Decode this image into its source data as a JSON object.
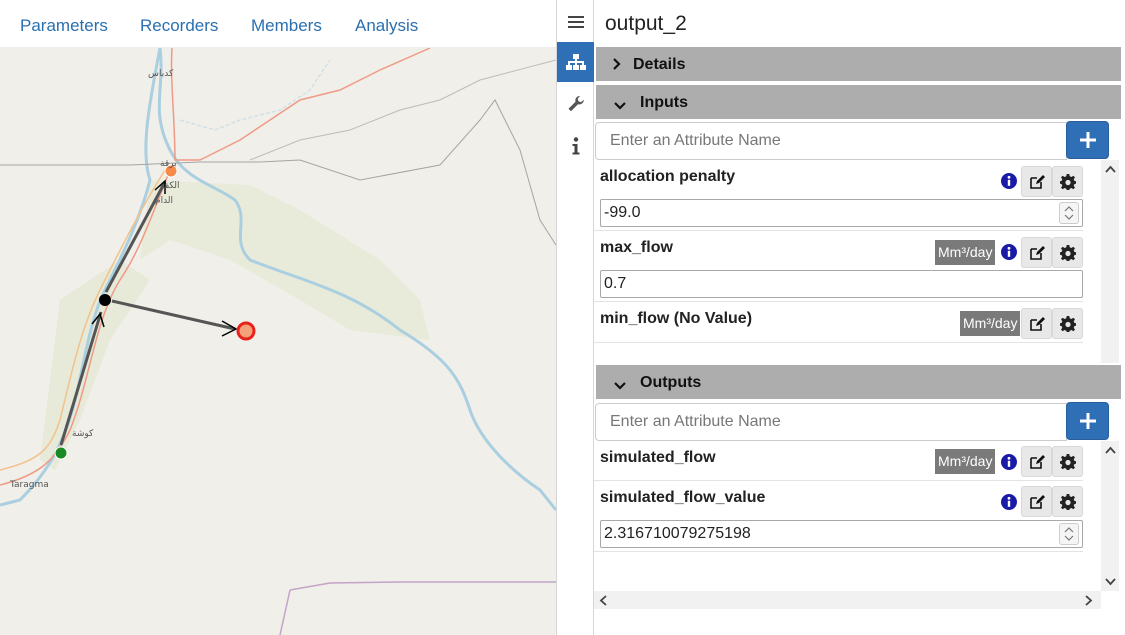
{
  "nav": {
    "tabs": [
      "Parameters",
      "Recorders",
      "Members",
      "Analysis"
    ]
  },
  "map": {
    "labels": [
      "كدباس",
      "برقة",
      "الكف",
      "الدام",
      "كوشة",
      "Taragma"
    ]
  },
  "panel": {
    "title": "output_2",
    "details_label": "Details",
    "inputs_label": "Inputs",
    "outputs_label": "Outputs",
    "attr_placeholder": "Enter an Attribute Name",
    "inputs": [
      {
        "name": "allocation penalty",
        "unit": "",
        "value": "-99.0"
      },
      {
        "name": "max_flow",
        "unit": "Mm³/day",
        "value": "0.7"
      },
      {
        "name": "min_flow (No Value)",
        "unit": "Mm³/day",
        "value": ""
      }
    ],
    "outputs": [
      {
        "name": "simulated_flow",
        "unit": "Mm³/day",
        "value": ""
      },
      {
        "name": "simulated_flow_value",
        "unit": "",
        "value": "2.316710079275198"
      }
    ]
  },
  "colors": {
    "accent": "#2e6fb5",
    "section_header": "#adadad",
    "unit_badge": "#7a7a7a",
    "info_icon": "#1a1aa8",
    "link": "#2a6fb0",
    "node_orange": "#f58a4b",
    "node_red": "#e8211a",
    "node_green": "#1a8a22",
    "node_black": "#000000"
  },
  "icons": {
    "strip": [
      "hamburger-icon",
      "hierarchy-icon",
      "wrench-icon",
      "info-icon"
    ],
    "row_actions": [
      "info-icon",
      "edit-icon",
      "gear-icon"
    ]
  }
}
